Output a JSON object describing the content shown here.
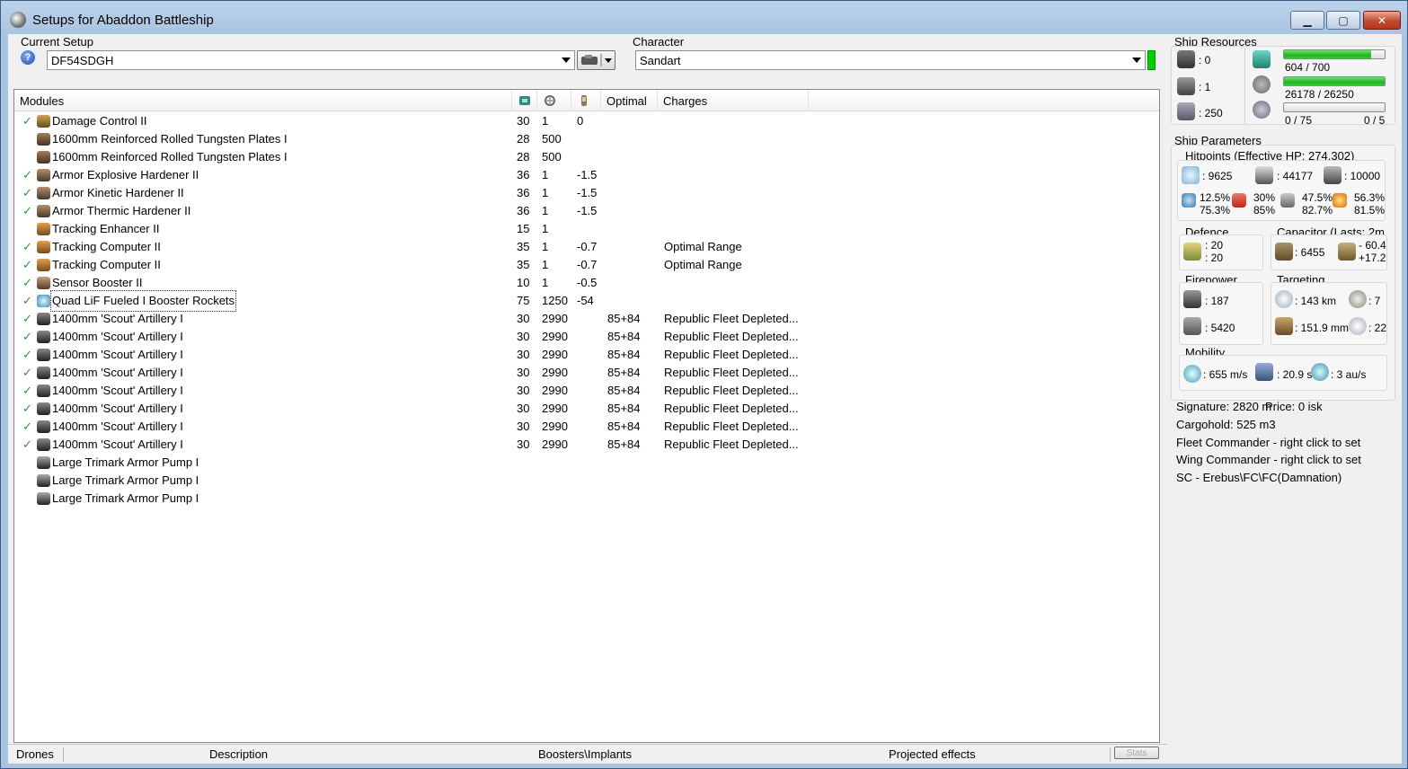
{
  "window": {
    "title": "Setups for Abaddon Battleship",
    "minimize": "▁",
    "maximize": "▢",
    "close": "✕"
  },
  "setup": {
    "label": "Current Setup",
    "value": "DF54SDGH",
    "help": "?"
  },
  "character": {
    "label": "Character",
    "value": "Sandart",
    "status_color": "#00d100"
  },
  "modules": {
    "headers": [
      "Modules",
      "",
      "",
      "",
      "Optimal",
      "Charges"
    ],
    "rows": [
      {
        "checked": true,
        "icon": "damage-control-icon",
        "name": "Damage Control II",
        "cpu": "30",
        "pg": "1",
        "cap": "0",
        "optimal": "",
        "charges": ""
      },
      {
        "checked": false,
        "icon": "armor-plate-icon",
        "name": "1600mm Reinforced Rolled Tungsten Plates I",
        "cpu": "28",
        "pg": "500",
        "cap": "",
        "optimal": "",
        "charges": ""
      },
      {
        "checked": false,
        "icon": "armor-plate-icon",
        "name": "1600mm Reinforced Rolled Tungsten Plates I",
        "cpu": "28",
        "pg": "500",
        "cap": "",
        "optimal": "",
        "charges": ""
      },
      {
        "checked": true,
        "icon": "hardener-icon",
        "name": "Armor Explosive Hardener II",
        "cpu": "36",
        "pg": "1",
        "cap": "-1.5",
        "optimal": "",
        "charges": ""
      },
      {
        "checked": true,
        "icon": "hardener-icon",
        "name": "Armor Kinetic Hardener II",
        "cpu": "36",
        "pg": "1",
        "cap": "-1.5",
        "optimal": "",
        "charges": ""
      },
      {
        "checked": true,
        "icon": "hardener-icon",
        "name": "Armor Thermic Hardener II",
        "cpu": "36",
        "pg": "1",
        "cap": "-1.5",
        "optimal": "",
        "charges": ""
      },
      {
        "checked": false,
        "icon": "tracking-enhancer-icon",
        "name": "Tracking Enhancer II",
        "cpu": "15",
        "pg": "1",
        "cap": "",
        "optimal": "",
        "charges": ""
      },
      {
        "checked": true,
        "icon": "tracking-computer-icon",
        "name": "Tracking Computer II",
        "cpu": "35",
        "pg": "1",
        "cap": "-0.7",
        "optimal": "",
        "charges": "Optimal Range"
      },
      {
        "checked": true,
        "icon": "tracking-computer-icon",
        "name": "Tracking Computer II",
        "cpu": "35",
        "pg": "1",
        "cap": "-0.7",
        "optimal": "",
        "charges": "Optimal Range"
      },
      {
        "checked": true,
        "icon": "sensor-booster-icon",
        "name": "Sensor Booster II",
        "cpu": "10",
        "pg": "1",
        "cap": "-0.5",
        "optimal": "",
        "charges": ""
      },
      {
        "checked": true,
        "icon": "afterburner-icon",
        "name": "Quad LiF Fueled I Booster Rockets",
        "cpu": "75",
        "pg": "1250",
        "cap": "-54",
        "optimal": "",
        "charges": "",
        "focused": true
      },
      {
        "checked": true,
        "icon": "artillery-icon",
        "name": "1400mm 'Scout' Artillery I",
        "cpu": "30",
        "pg": "2990",
        "cap": "",
        "optimal": "85+84",
        "charges": "Republic Fleet Depleted..."
      },
      {
        "checked": true,
        "icon": "artillery-icon",
        "name": "1400mm 'Scout' Artillery I",
        "cpu": "30",
        "pg": "2990",
        "cap": "",
        "optimal": "85+84",
        "charges": "Republic Fleet Depleted..."
      },
      {
        "checked": true,
        "icon": "artillery-icon",
        "name": "1400mm 'Scout' Artillery I",
        "cpu": "30",
        "pg": "2990",
        "cap": "",
        "optimal": "85+84",
        "charges": "Republic Fleet Depleted..."
      },
      {
        "checked": true,
        "icon": "artillery-icon",
        "name": "1400mm 'Scout' Artillery I",
        "cpu": "30",
        "pg": "2990",
        "cap": "",
        "optimal": "85+84",
        "charges": "Republic Fleet Depleted..."
      },
      {
        "checked": true,
        "icon": "artillery-icon",
        "name": "1400mm 'Scout' Artillery I",
        "cpu": "30",
        "pg": "2990",
        "cap": "",
        "optimal": "85+84",
        "charges": "Republic Fleet Depleted..."
      },
      {
        "checked": true,
        "icon": "artillery-icon",
        "name": "1400mm 'Scout' Artillery I",
        "cpu": "30",
        "pg": "2990",
        "cap": "",
        "optimal": "85+84",
        "charges": "Republic Fleet Depleted..."
      },
      {
        "checked": true,
        "icon": "artillery-icon",
        "name": "1400mm 'Scout' Artillery I",
        "cpu": "30",
        "pg": "2990",
        "cap": "",
        "optimal": "85+84",
        "charges": "Republic Fleet Depleted..."
      },
      {
        "checked": true,
        "icon": "artillery-icon",
        "name": "1400mm 'Scout' Artillery I",
        "cpu": "30",
        "pg": "2990",
        "cap": "",
        "optimal": "85+84",
        "charges": "Republic Fleet Depleted..."
      },
      {
        "checked": false,
        "icon": "rig-icon",
        "name": "Large Trimark Armor Pump I",
        "cpu": "",
        "pg": "",
        "cap": "",
        "optimal": "",
        "charges": ""
      },
      {
        "checked": false,
        "icon": "rig-icon",
        "name": "Large Trimark Armor Pump I",
        "cpu": "",
        "pg": "",
        "cap": "",
        "optimal": "",
        "charges": ""
      },
      {
        "checked": false,
        "icon": "rig-icon",
        "name": "Large Trimark Armor Pump I",
        "cpu": "",
        "pg": "",
        "cap": "",
        "optimal": "",
        "charges": ""
      }
    ]
  },
  "statusbar": {
    "drones": "Drones",
    "description": "Description",
    "boosters": "Boosters\\Implants",
    "projected": "Projected effects",
    "stats": "Stats"
  },
  "resources": {
    "label": "Ship Resources",
    "turret_slots": ": 0",
    "launcher_slots": ": 1",
    "drone_bay": ": 250",
    "cpu_text": "604 / 700",
    "cpu_fraction": 0.863,
    "pg_text": "26178 / 26250",
    "pg_fraction": 0.997,
    "drone_bw_text": "0 / 75",
    "drone_count_text": "0 / 5",
    "drone_fraction": 0.0
  },
  "params": {
    "label": "Ship Parameters",
    "hitpoints_label": "Hitpoints (Effective HP: 274,302)",
    "shield_hp": ": 9625",
    "armor_hp": ": 44177",
    "structure_hp": ": 10000",
    "res_em": [
      "12.5%",
      "75.3%"
    ],
    "res_thermal": [
      "30%",
      "85%"
    ],
    "res_kinetic": [
      "47.5%",
      "82.7%"
    ],
    "res_explosive": [
      "56.3%",
      "81.5%"
    ],
    "defence_label": "Defence",
    "defence_a": ": 20",
    "defence_b": ": 20",
    "capacitor_label": "Capacitor (Lasts: 2m",
    "cap_amount": ": 6455",
    "cap_use": "- 60.4",
    "cap_regen": "+17.2",
    "firepower_label": "Firepower",
    "dps": ": 187",
    "volley": ": 5420",
    "targeting_label": "Targeting",
    "target_range": ": 143 km",
    "max_targets": ": 7",
    "scan_res": ": 151.9 mm",
    "sensor_strength": ": 22",
    "mobility_label": "Mobility",
    "velocity": ": 655 m/s",
    "align_time": ": 20.9 s",
    "warp_speed": ": 3 au/s",
    "signature": "Signature: 2820 m",
    "price": "Price: 0 isk",
    "cargohold": "Cargohold: 525 m3",
    "fleet_commander": "Fleet Commander - right click to set",
    "wing_commander": "Wing Commander - right click to set",
    "squad": "SC - Erebus\\FC\\FC(Damnation)"
  }
}
